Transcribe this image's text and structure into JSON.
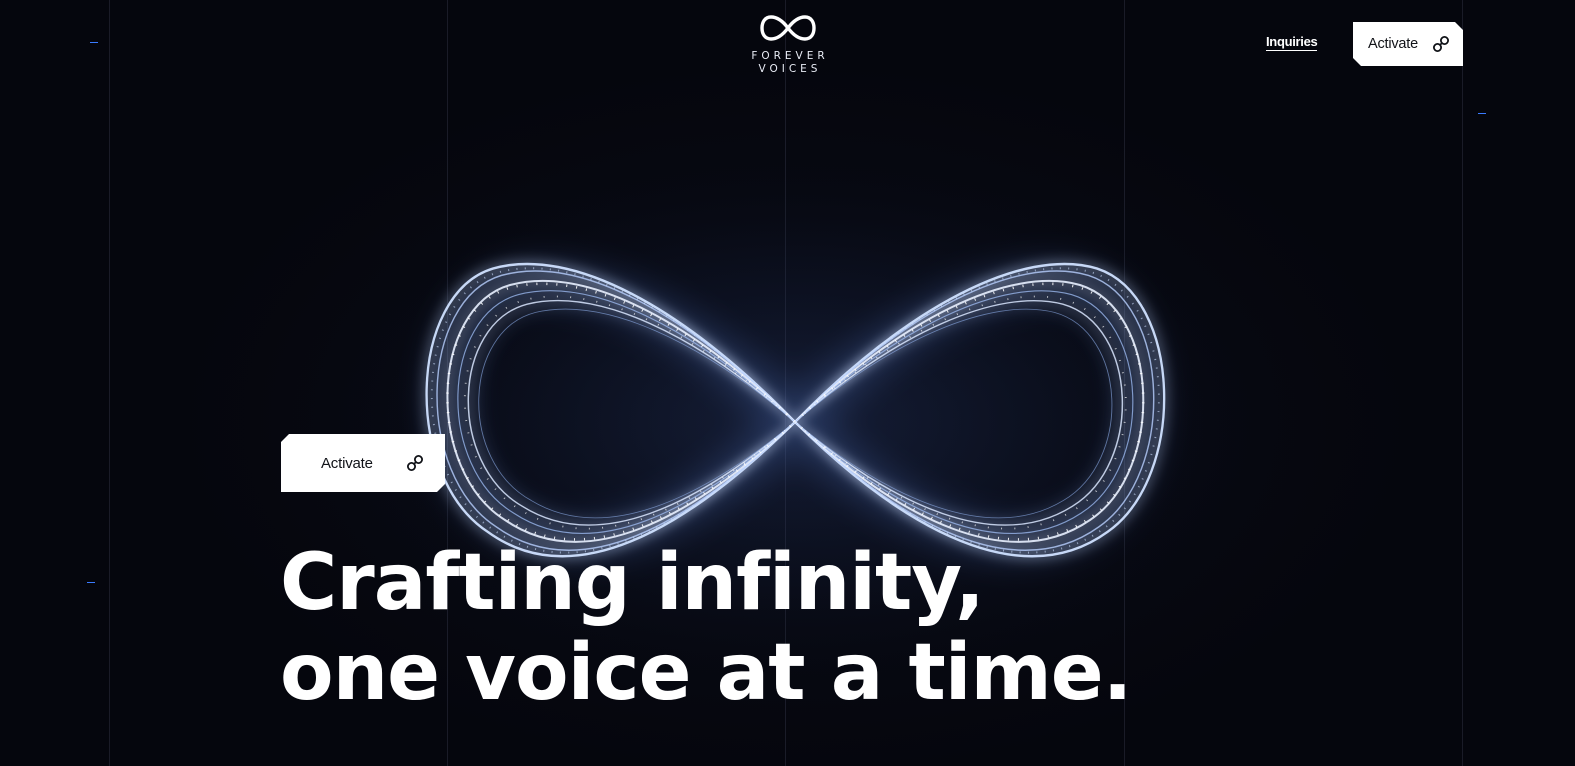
{
  "brand": {
    "logo_icon": "infinity-icon",
    "line1": "FOREVER",
    "line2": "VOICES"
  },
  "nav": {
    "inquiries_label": "Inquiries",
    "activate_label": "Activate",
    "activate_icon": "link-icon"
  },
  "hero": {
    "activate_label": "Activate",
    "activate_icon": "link-icon",
    "headline_line1": "Crafting infinity,",
    "headline_line2": "one voice at a time.",
    "visual": "glowing-infinity-symbol"
  },
  "colors": {
    "background": "#05060d",
    "accent_tick": "#3a7bff",
    "button_bg": "#ffffff",
    "button_text": "#111318",
    "glow": "#9fc4ff"
  }
}
